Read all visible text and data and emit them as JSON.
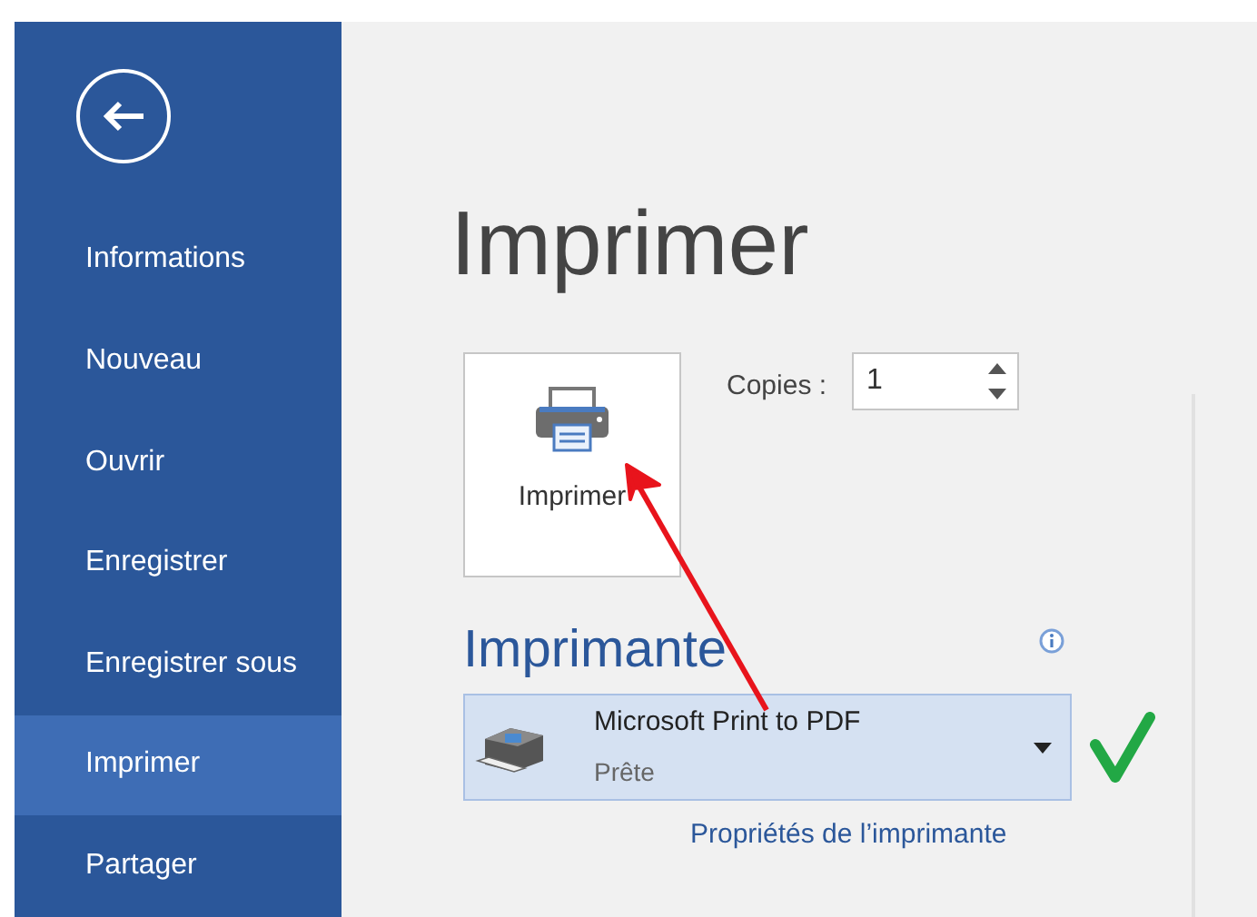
{
  "sidebar": {
    "items": [
      {
        "label": "Informations",
        "selected": false
      },
      {
        "label": "Nouveau",
        "selected": false
      },
      {
        "label": "Ouvrir",
        "selected": false
      },
      {
        "label": "Enregistrer",
        "selected": false
      },
      {
        "label": "Enregistrer sous",
        "selected": false
      },
      {
        "label": "Imprimer",
        "selected": true
      },
      {
        "label": "Partager",
        "selected": false
      }
    ]
  },
  "title": "Imprimer",
  "print_button": {
    "label": "Imprimer"
  },
  "copies": {
    "label": "Copies :",
    "value": "1"
  },
  "printer": {
    "heading": "Imprimante",
    "name": "Microsoft Print to PDF",
    "status": "Prête",
    "properties_link": "Propriétés de l’imprimante"
  }
}
